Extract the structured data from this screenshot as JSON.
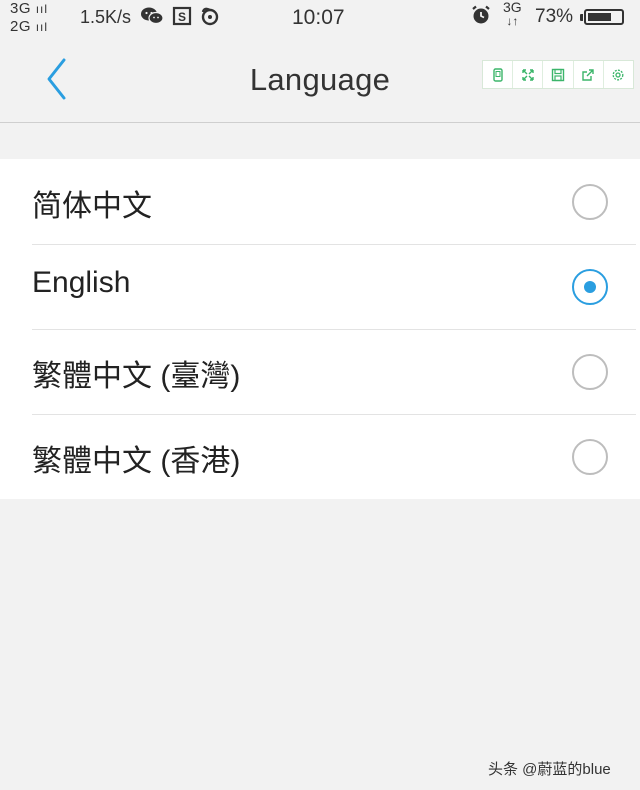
{
  "status_bar": {
    "sim1_network": "3G",
    "sim1_bars": "ııl",
    "sim2_network": "2G",
    "sim2_bars": "ııl",
    "net_speed": "1.5K/s",
    "time": "10:07",
    "data_network": "3G",
    "data_arrows": "↓↑",
    "battery_percent": "73%",
    "battery_level": 0.73,
    "icons": [
      "wechat-icon",
      "s-app-icon",
      "netease-icon",
      "alarm-clock-icon",
      "battery-icon"
    ]
  },
  "header": {
    "title": "Language",
    "back_icon": "chevron-left-icon",
    "toolbar_icons": [
      "phone-icon",
      "expand-icon",
      "save-icon",
      "share-icon",
      "gear-icon"
    ]
  },
  "languages": {
    "items": [
      {
        "label": "简体中文",
        "selected": false
      },
      {
        "label": "English",
        "selected": true
      },
      {
        "label": "繁體中文 (臺灣)",
        "selected": false
      },
      {
        "label": "繁體中文 (香港)",
        "selected": false
      }
    ]
  },
  "watermark": "头条 @蔚蓝的blue",
  "colors": {
    "accent": "#2a9ee0",
    "toolbar_icon": "#3bb56a",
    "background": "#f2f2f2",
    "list_background": "#ffffff"
  }
}
